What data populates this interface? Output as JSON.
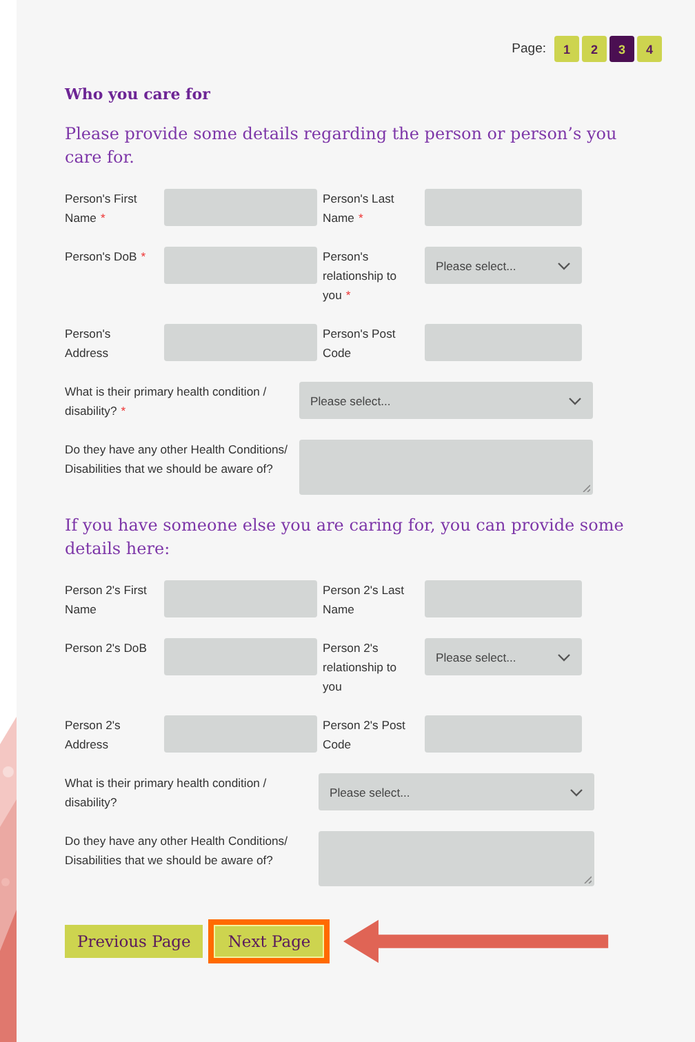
{
  "pagination": {
    "label": "Page:",
    "pages": [
      {
        "label": "1",
        "selected": false
      },
      {
        "label": "2",
        "selected": false
      },
      {
        "label": "3",
        "selected": true
      },
      {
        "label": "4",
        "selected": false
      }
    ]
  },
  "title": "Who you care for",
  "sections": [
    {
      "heading": "Please provide some details regarding the person or person’s you care for.",
      "rows": [
        {
          "kind": "pair",
          "fields": [
            {
              "label": "Person's First Name",
              "required_mark": "*",
              "kind": "text"
            },
            {
              "label": "Person's Last Name",
              "required_mark": "*",
              "kind": "text"
            }
          ]
        },
        {
          "kind": "pair",
          "fields": [
            {
              "label": "Person's DoB",
              "required_mark": "*",
              "kind": "text"
            },
            {
              "label": "Person's relationship to you",
              "required_mark": "*",
              "kind": "select",
              "value": "Please select..."
            }
          ]
        },
        {
          "kind": "pair",
          "fields": [
            {
              "label": "Person's Address",
              "kind": "text"
            },
            {
              "label": "Person's Post Code",
              "kind": "text"
            }
          ]
        },
        {
          "kind": "wide",
          "fields": [
            {
              "label": "What is their primary health condition / disability?",
              "required_mark": "*",
              "kind": "select",
              "value": "Please select..."
            }
          ]
        },
        {
          "kind": "wide",
          "fields": [
            {
              "label": "Do they have any other Health Conditions/ Disabilities that we should be aware of?",
              "kind": "textarea"
            }
          ]
        }
      ]
    },
    {
      "heading": "If you have someone else you are caring for, you can provide some details here:",
      "rows": [
        {
          "kind": "pair",
          "fields": [
            {
              "label": "Person 2's First Name",
              "kind": "text"
            },
            {
              "label": "Person 2's Last Name",
              "kind": "text"
            }
          ]
        },
        {
          "kind": "pair",
          "fields": [
            {
              "label": "Person 2's DoB",
              "kind": "text"
            },
            {
              "label": "Person 2's relationship to you",
              "kind": "select",
              "value": "Please select..."
            }
          ]
        },
        {
          "kind": "pair",
          "fields": [
            {
              "label": "Person 2's Address",
              "kind": "text"
            },
            {
              "label": "Person 2's Post Code",
              "kind": "text"
            }
          ]
        },
        {
          "kind": "wide2",
          "fields": [
            {
              "label": "What is their primary health condition / disability?",
              "kind": "select",
              "value": "Please select..."
            }
          ]
        },
        {
          "kind": "wide2",
          "fields": [
            {
              "label": "Do they have any other Health Conditions/ Disabilities that we should be aware of?",
              "kind": "textarea"
            }
          ]
        }
      ]
    }
  ],
  "buttons": [
    {
      "label": "Previous Page",
      "highlighted": false
    },
    {
      "label": "Next Page",
      "highlighted": true
    }
  ]
}
